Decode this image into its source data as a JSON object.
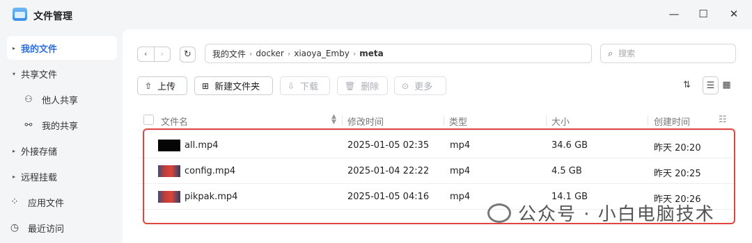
{
  "app": {
    "title": "文件管理"
  },
  "window": {
    "minimize": "—",
    "maximize": "☐",
    "close": "✕"
  },
  "sidebar": {
    "items": [
      {
        "label": "我的文件",
        "active": true
      },
      {
        "label": "共享文件"
      },
      {
        "label": "他人共享"
      },
      {
        "label": "我的共享"
      },
      {
        "label": "外接存储"
      },
      {
        "label": "远程挂载"
      },
      {
        "label": "应用文件"
      },
      {
        "label": "最近访问"
      }
    ]
  },
  "breadcrumb": {
    "items": [
      "我的文件",
      "docker",
      "xiaoya_Emby",
      "meta"
    ]
  },
  "search": {
    "placeholder": "搜索"
  },
  "toolbar": {
    "upload": "上传",
    "new_folder": "新建文件夹",
    "download": "下载",
    "delete": "删除",
    "more": "更多"
  },
  "table": {
    "columns": [
      "文件名",
      "修改时间",
      "类型",
      "大小",
      "创建时间"
    ],
    "rows": [
      {
        "name": "all.mp4",
        "modified": "2025-01-05 02:35",
        "type": "mp4",
        "size": "34.6 GB",
        "created": "昨天 20:20",
        "thumb": "dark"
      },
      {
        "name": "config.mp4",
        "modified": "2025-01-04 22:22",
        "type": "mp4",
        "size": "4.5 GB",
        "created": "昨天 20:25",
        "thumb": "red"
      },
      {
        "name": "pikpak.mp4",
        "modified": "2025-01-05 04:16",
        "type": "mp4",
        "size": "14.1 GB",
        "created": "昨天 20:26",
        "thumb": "red"
      }
    ]
  },
  "watermark": {
    "text": "公众号 · 小白电脑技术"
  },
  "colors": {
    "accent": "#2d6fe0",
    "highlight": "#e0463f"
  }
}
